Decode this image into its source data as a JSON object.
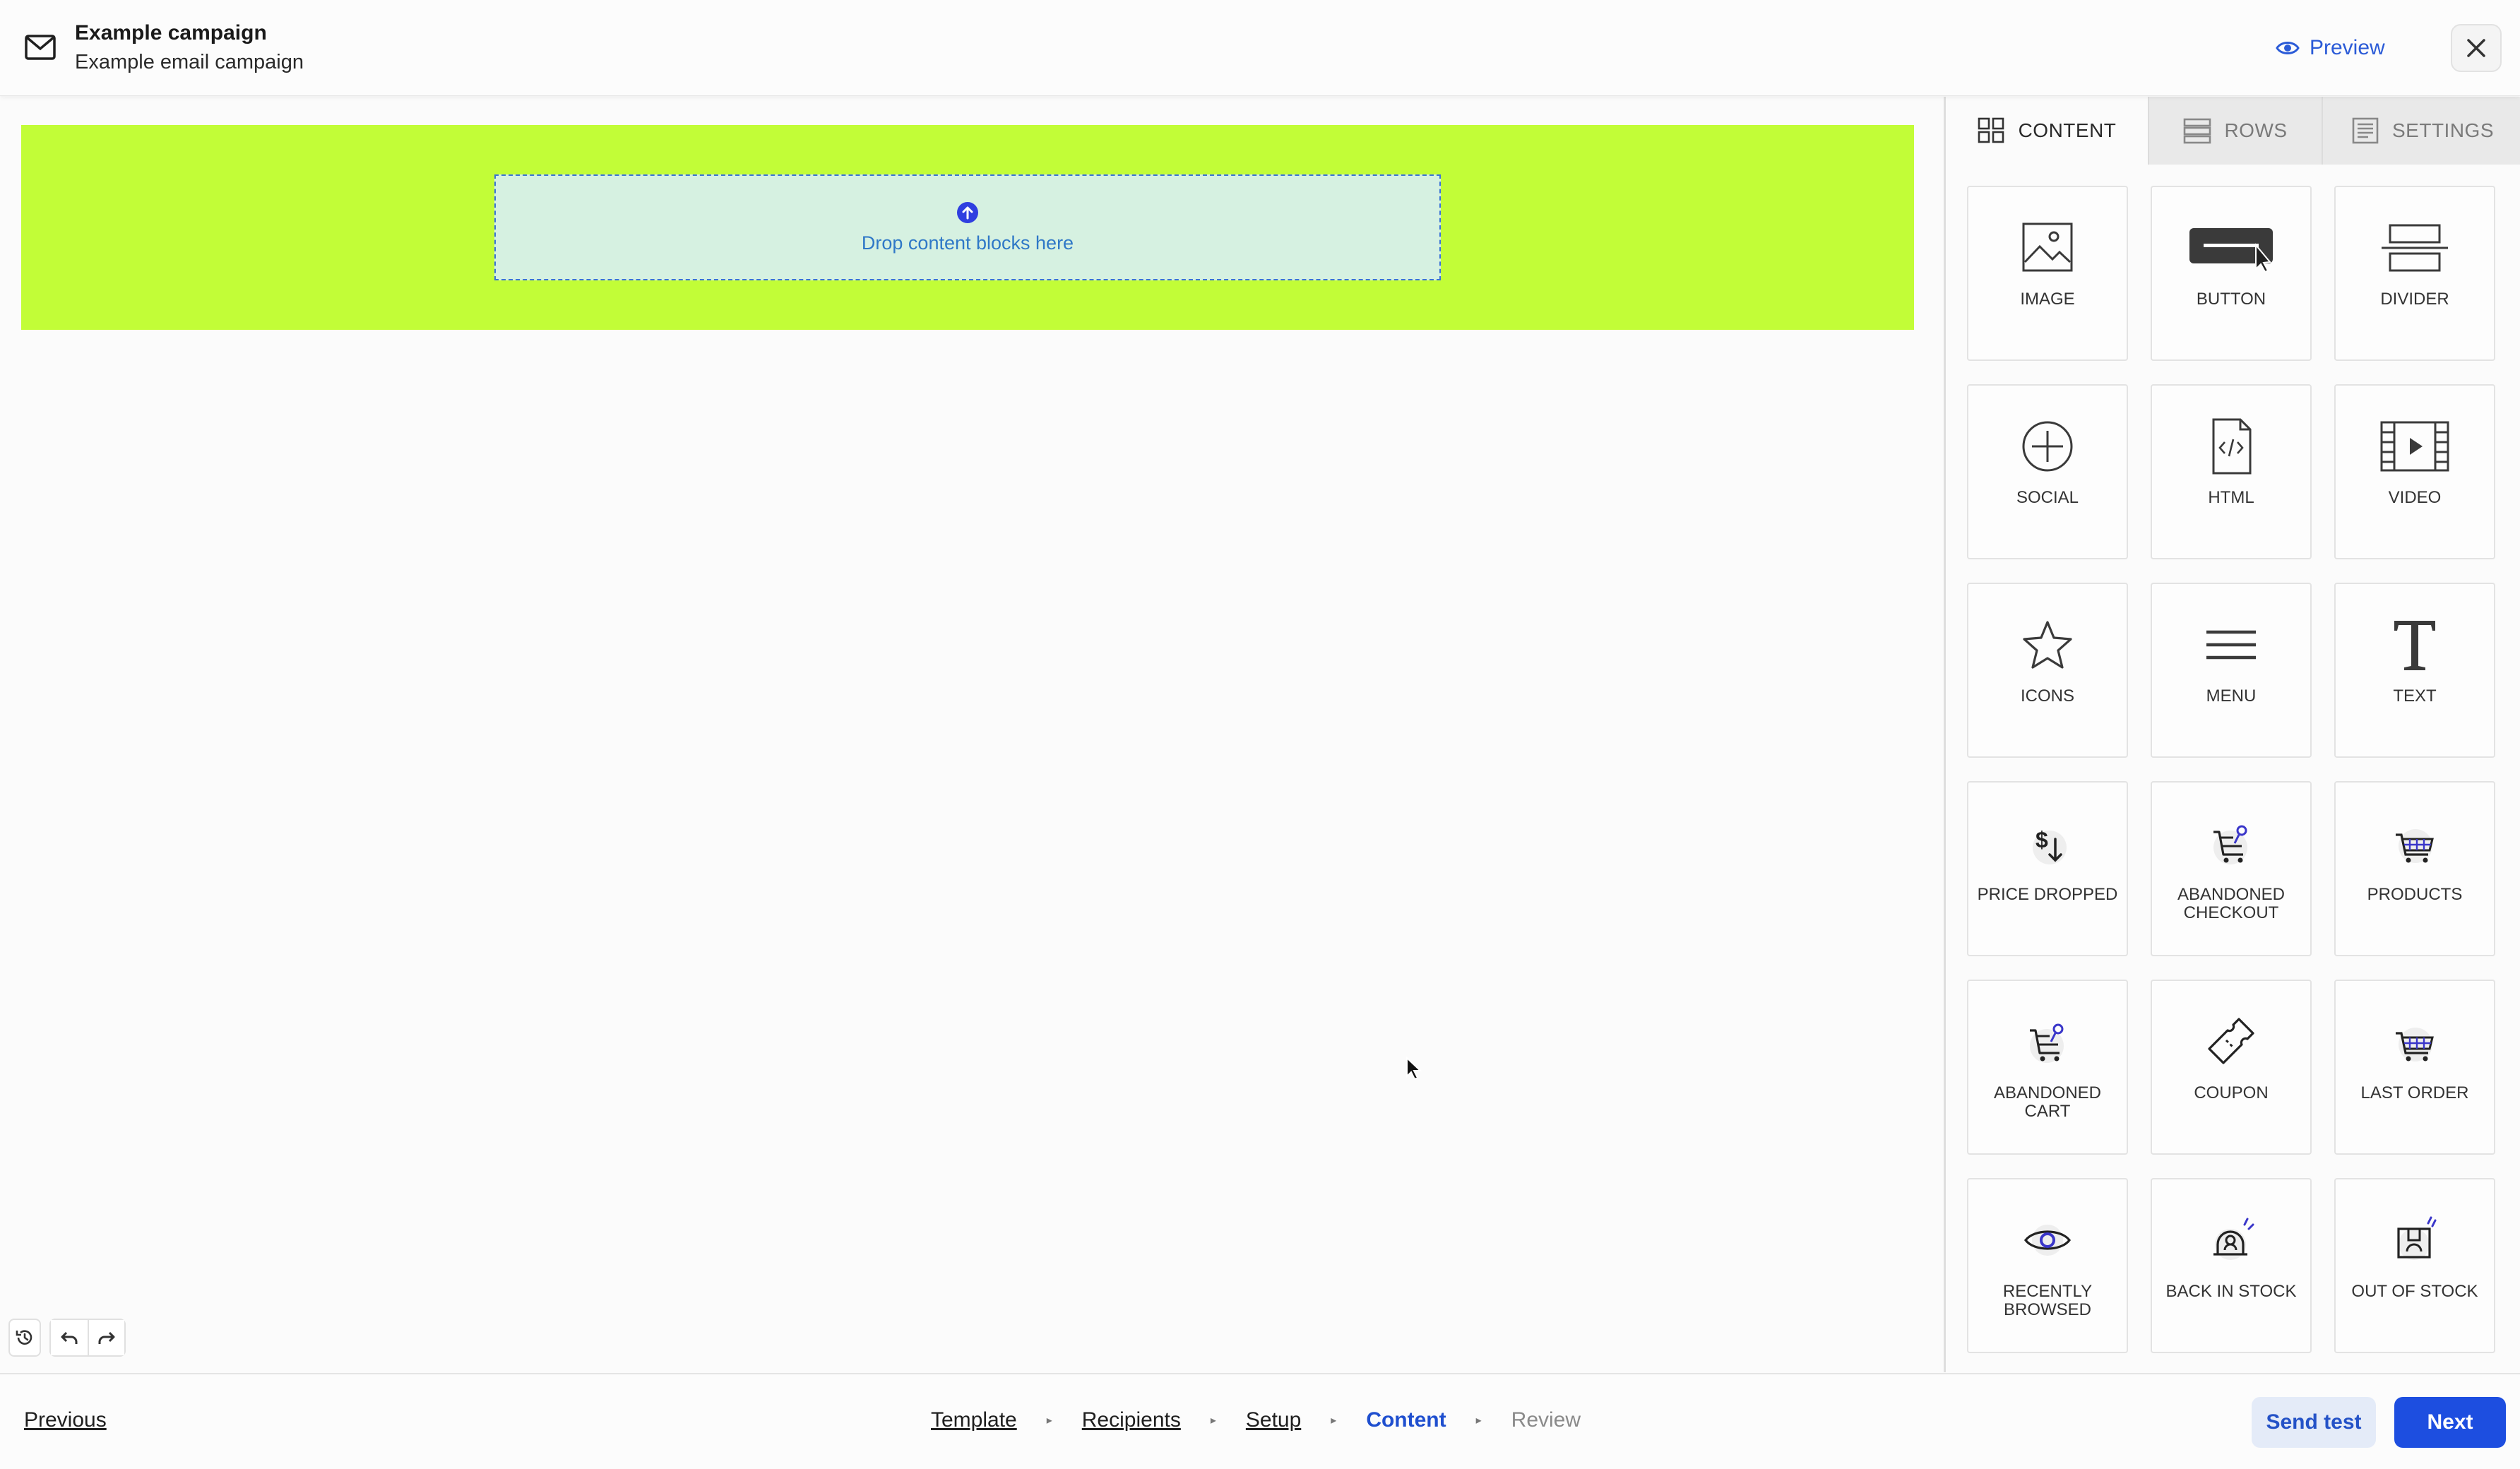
{
  "header": {
    "title": "Example campaign",
    "subtitle": "Example email campaign",
    "preview_label": "Preview"
  },
  "canvas": {
    "row_color": "#c2fd37",
    "drop_text": "Drop content blocks here"
  },
  "panel": {
    "tabs": [
      {
        "label": "CONTENT",
        "active": true
      },
      {
        "label": "ROWS",
        "active": false
      },
      {
        "label": "SETTINGS",
        "active": false
      }
    ],
    "tiles": [
      {
        "label": "IMAGE",
        "icon": "image-icon"
      },
      {
        "label": "BUTTON",
        "icon": "button-block-icon"
      },
      {
        "label": "DIVIDER",
        "icon": "divider-icon"
      },
      {
        "label": "SOCIAL",
        "icon": "social-icon"
      },
      {
        "label": "HTML",
        "icon": "html-icon"
      },
      {
        "label": "VIDEO",
        "icon": "video-icon"
      },
      {
        "label": "ICONS",
        "icon": "star-icon"
      },
      {
        "label": "MENU",
        "icon": "menu-icon"
      },
      {
        "label": "TEXT",
        "icon": "text-icon"
      },
      {
        "label": "PRICE DROPPED",
        "icon": "price-drop-icon"
      },
      {
        "label": "ABANDONED CHECKOUT",
        "icon": "abandoned-checkout-icon"
      },
      {
        "label": "PRODUCTS",
        "icon": "products-cart-icon"
      },
      {
        "label": "ABANDONED CART",
        "icon": "abandoned-cart-icon"
      },
      {
        "label": "COUPON",
        "icon": "coupon-icon"
      },
      {
        "label": "LAST ORDER",
        "icon": "last-order-icon"
      },
      {
        "label": "RECENTLY BROWSED",
        "icon": "eye-icon"
      },
      {
        "label": "BACK IN STOCK",
        "icon": "back-in-stock-icon"
      },
      {
        "label": "OUT OF STOCK",
        "icon": "out-of-stock-icon"
      }
    ]
  },
  "footer": {
    "previous_label": "Previous",
    "steps": [
      {
        "label": "Template",
        "state": "done"
      },
      {
        "label": "Recipients",
        "state": "done"
      },
      {
        "label": "Setup",
        "state": "done"
      },
      {
        "label": "Content",
        "state": "current"
      },
      {
        "label": "Review",
        "state": "future"
      }
    ],
    "send_test_label": "Send test",
    "next_label": "Next"
  },
  "colors": {
    "accent": "#1d4ee0",
    "link": "#2b5bd7",
    "drop_zone": "#d6f1e1"
  }
}
